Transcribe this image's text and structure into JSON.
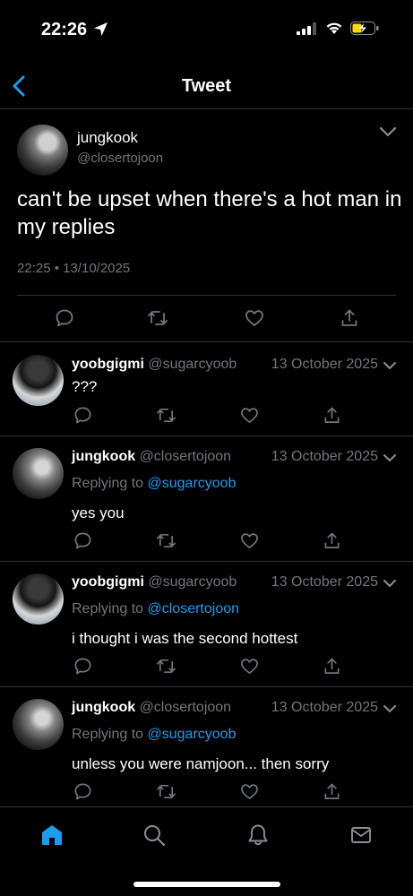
{
  "status_bar": {
    "time": "22:26"
  },
  "nav": {
    "title": "Tweet"
  },
  "main_tweet": {
    "name": "jungkook",
    "handle": "@closertojoon",
    "text": "can't be upset when there's a hot man in my replies",
    "meta": "22:25 • 13/10/2025"
  },
  "replies": [
    {
      "name": "yoobgigmi",
      "handle": "@sugarcyoob",
      "date": "13 October 2025",
      "replying_prefix": "",
      "replying_to": "",
      "text": "???"
    },
    {
      "name": "jungkook",
      "handle": "@closertojoon",
      "date": "13 October 2025",
      "replying_prefix": "Replying to",
      "replying_to": "@sugarcyoob",
      "text": "yes you"
    },
    {
      "name": "yoobgigmi",
      "handle": "@sugarcyoob",
      "date": "13 October 2025",
      "replying_prefix": "Replying to",
      "replying_to": "@closertojoon",
      "text": "i thought i was the second hottest"
    },
    {
      "name": "jungkook",
      "handle": "@closertojoon",
      "date": "13 October 2025",
      "replying_prefix": "Replying to",
      "replying_to": "@sugarcyoob",
      "text": "unless you were namjoon... then sorry"
    }
  ],
  "icons": {
    "reply": "reply-icon",
    "retweet": "retweet-icon",
    "like": "like-icon",
    "share": "share-icon",
    "home": "home-icon",
    "search": "search-icon",
    "notifications": "bell-icon",
    "messages": "mail-icon"
  },
  "colors": {
    "accent": "#1d9bf0",
    "background": "#000000",
    "muted": "#71767b",
    "battery": "#ffd60a"
  }
}
